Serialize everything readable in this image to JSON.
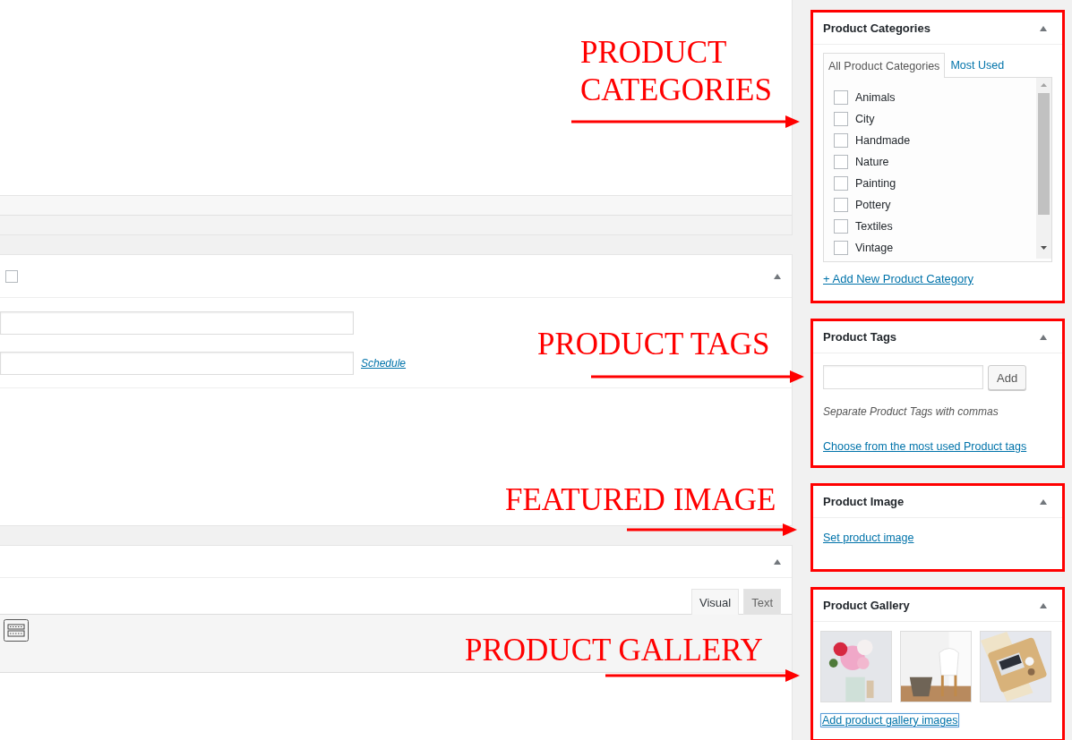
{
  "editor_panels": {
    "details_panel": {
      "checkbox": {
        "checked": false
      },
      "schedule_link": "Schedule"
    },
    "content_panel": {
      "tabs": [
        {
          "label": "Visual",
          "selected": true
        },
        {
          "label": "Text",
          "selected": false
        }
      ]
    }
  },
  "sidebar": {
    "categories": {
      "title": "Product Categories",
      "highlighted": true,
      "tabs": [
        {
          "label": "All Product Categories",
          "selected": true
        },
        {
          "label": "Most Used",
          "selected": false
        }
      ],
      "items": [
        {
          "label": "Animals",
          "checked": false
        },
        {
          "label": "City",
          "checked": false
        },
        {
          "label": "Handmade",
          "checked": false
        },
        {
          "label": "Nature",
          "checked": false
        },
        {
          "label": "Painting",
          "checked": false
        },
        {
          "label": "Pottery",
          "checked": false
        },
        {
          "label": "Textiles",
          "checked": false
        },
        {
          "label": "Vintage",
          "checked": false
        }
      ],
      "add_link": "+ Add New Product Category"
    },
    "tags": {
      "title": "Product Tags",
      "highlighted": true,
      "add_button": "Add",
      "hint": "Separate Product Tags with commas",
      "link": "Choose from the most used Product tags"
    },
    "image": {
      "title": "Product Image",
      "highlighted": true,
      "link": "Set product image"
    },
    "gallery": {
      "title": "Product Gallery",
      "highlighted": true,
      "link": "Add product gallery images"
    }
  },
  "annotations": [
    {
      "text": "PRODUCT CATEGORIES"
    },
    {
      "text": "PRODUCT TAGS"
    },
    {
      "text": "FEATURED IMAGE"
    },
    {
      "text": "PRODUCT GALLERY"
    }
  ]
}
